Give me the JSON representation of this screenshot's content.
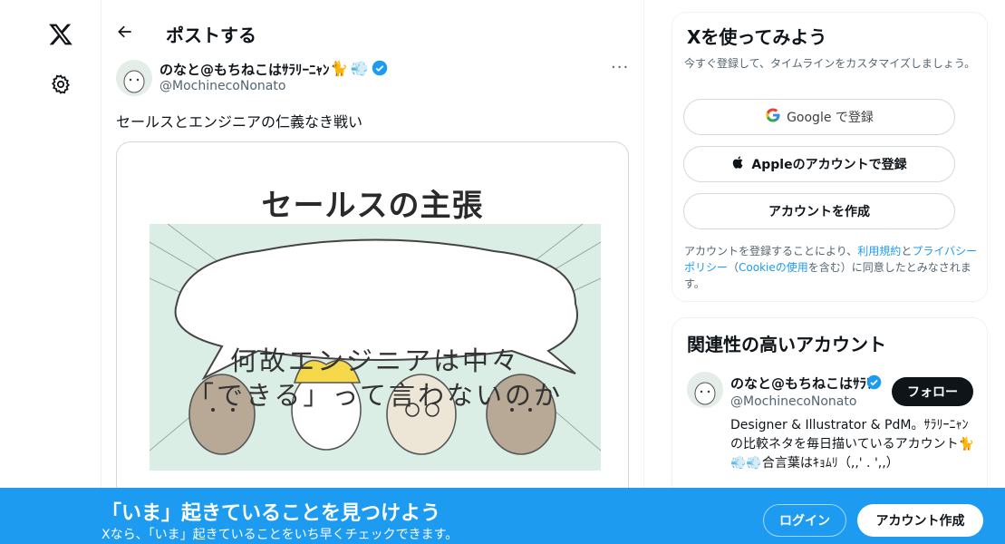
{
  "nav": {
    "x_logo_icon": "x-logo-icon",
    "settings_icon": "gear-icon"
  },
  "header": {
    "title": "ポストする"
  },
  "post": {
    "author_name": "のなと@もちねこはｻﾗﾘｰﾆｬﾝ",
    "author_handle": "@MochinecoNonato",
    "text": "セールスとエンジニアの仁義なき戦い",
    "media": {
      "title": "セールスの主張",
      "bubble_line1": "何故エンジニアは中々",
      "bubble_line2": "「できる」って言わないのか"
    }
  },
  "signup": {
    "title": "Xを使ってみよう",
    "subtitle": "今すぐ登録して、タイムラインをカスタマイズしましょう。",
    "google_label": "Google で登録",
    "apple_label": "Appleのアカウントで登録",
    "create_label": "アカウントを作成",
    "terms_prefix": "アカウントを登録することにより、",
    "terms_link": "利用規約",
    "terms_and": "と",
    "privacy_link": "プライバシーポリシー",
    "cookie_open": "（",
    "cookie_link": "Cookieの使用",
    "terms_suffix": "を含む）に同意したとみなされます。"
  },
  "related": {
    "title": "関連性の高いアカウント",
    "name": "のなと@もちねこはｻﾗﾘｰﾆｬﾝ",
    "handle": "@MochinecoNonato",
    "follow_label": "フォロー",
    "bio": "Designer & Illustrator & PdM。ｻﾗﾘｰﾆｬﾝの比較ネタを毎日描いているアカウント🐈💨💨合言葉はｷｮﾑﾘ（,,' . ',,）"
  },
  "banner": {
    "title": "「いま」起きていることを見つけよう",
    "subtitle": "Xなら、「いま」起きていることをいち早くチェックできます。",
    "login_label": "ログイン",
    "create_label": "アカウント作成"
  },
  "colors": {
    "accent": "#1d9bf0",
    "verified": "#1d9bf0",
    "text": "#0f1419",
    "muted": "#536471"
  }
}
